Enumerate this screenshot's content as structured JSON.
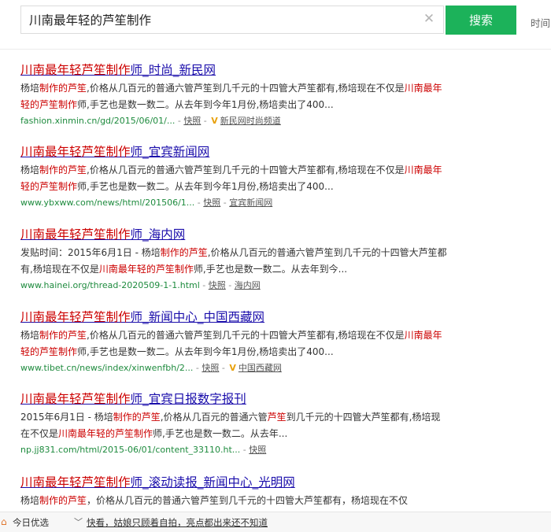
{
  "search": {
    "query": "川南最年轻的芦笙制作",
    "button_label": "搜索",
    "time_filter_label": "时间"
  },
  "results": [
    {
      "title": [
        {
          "t": "川南最年轻芦笙制作",
          "hl": true
        },
        {
          "t": "师_时尚_新民网",
          "hl": false
        }
      ],
      "desc": [
        {
          "t": "杨培",
          "hl": false
        },
        {
          "t": "制作的芦笙",
          "hl": true
        },
        {
          "t": ",价格从几百元的普通六管芦笙到几千元的十四管大芦笙都有,杨培现在不仅是",
          "hl": false
        },
        {
          "t": "川南最年轻的芦笙制作",
          "hl": true
        },
        {
          "t": "师,手艺也是数一数二。从去年到今年1月份,杨培卖出了400...",
          "hl": false
        }
      ],
      "url": "fashion.xinmin.cn/gd/2015/06/01/...",
      "cache": "快照",
      "verified": true,
      "source": "新民网时尚频道"
    },
    {
      "title": [
        {
          "t": "川南最年轻芦笙制作",
          "hl": true
        },
        {
          "t": "师_宜宾新闻网",
          "hl": false
        }
      ],
      "desc": [
        {
          "t": "杨培",
          "hl": false
        },
        {
          "t": "制作的芦笙",
          "hl": true
        },
        {
          "t": ",价格从几百元的普通六管芦笙到几千元的十四管大芦笙都有,杨培现在不仅是",
          "hl": false
        },
        {
          "t": "川南最年轻的芦笙制作",
          "hl": true
        },
        {
          "t": "师,手艺也是数一数二。从去年到今年1月份,杨培卖出了400...",
          "hl": false
        }
      ],
      "url": "www.ybxww.com/news/html/201506/1...",
      "cache": "快照",
      "verified": false,
      "source": "宜宾新闻网"
    },
    {
      "title": [
        {
          "t": "川南最年轻芦笙制作",
          "hl": true
        },
        {
          "t": "师_海内网",
          "hl": false
        }
      ],
      "desc": [
        {
          "t": "发贴时间：2015年6月1日 - 杨培",
          "hl": false
        },
        {
          "t": "制作的芦笙",
          "hl": true
        },
        {
          "t": ",价格从几百元的普通六管芦笙到几千元的十四管大芦笙都有,杨培现在不仅是",
          "hl": false
        },
        {
          "t": "川南最年轻的芦笙制作",
          "hl": true
        },
        {
          "t": "师,手艺也是数一数二。从去年到今...",
          "hl": false
        }
      ],
      "url": "www.hainei.org/thread-2020509-1-1.html",
      "cache": "快照",
      "verified": false,
      "source": "海内网"
    },
    {
      "title": [
        {
          "t": "川南最年轻芦笙制作",
          "hl": true
        },
        {
          "t": "师_新闻中心_中国西藏网",
          "hl": false
        }
      ],
      "desc": [
        {
          "t": "杨培",
          "hl": false
        },
        {
          "t": "制作的芦笙",
          "hl": true
        },
        {
          "t": ",价格从几百元的普通六管芦笙到几千元的十四管大芦笙都有,杨培现在不仅是",
          "hl": false
        },
        {
          "t": "川南最年轻的芦笙制作",
          "hl": true
        },
        {
          "t": "师,手艺也是数一数二。从去年到今年1月份,杨培卖出了400...",
          "hl": false
        }
      ],
      "url": "www.tibet.cn/news/index/xinwenfbh/2...",
      "cache": "快照",
      "verified": true,
      "source": "中国西藏网"
    },
    {
      "title": [
        {
          "t": "川南最年轻芦笙制作",
          "hl": true
        },
        {
          "t": "师_宜宾日报数字报刊",
          "hl": false
        }
      ],
      "desc": [
        {
          "t": "2015年6月1日 - 杨培",
          "hl": false
        },
        {
          "t": "制作的芦笙",
          "hl": true
        },
        {
          "t": ",价格从几百元的普通六管",
          "hl": false
        },
        {
          "t": "芦笙",
          "hl": true
        },
        {
          "t": "到几千元的十四管大芦笙都有,杨培现在不仅是",
          "hl": false
        },
        {
          "t": "川南最年轻的芦笙制作",
          "hl": true
        },
        {
          "t": "师,手艺也是数一数二。从去年...",
          "hl": false
        }
      ],
      "url": "np.jj831.com/html/2015-06/01/content_33110.ht...",
      "cache": "快照",
      "verified": false,
      "source": ""
    },
    {
      "title": [
        {
          "t": "川南最年轻芦笙制作",
          "hl": true
        },
        {
          "t": "师_滚动读报_新闻中心_光明网",
          "hl": false
        }
      ],
      "desc": [
        {
          "t": "杨培",
          "hl": false
        },
        {
          "t": "制作的芦笙",
          "hl": true
        },
        {
          "t": "，价格从几百元的普通六管芦笙到几千元的十四管大芦笙都有，杨培现在不仅",
          "hl": false
        }
      ],
      "url": "",
      "cache": "",
      "verified": false,
      "source": ""
    }
  ],
  "bottombar": {
    "today_label": "今日优选",
    "news_text": "快看，姑娘只顾着自拍，亮点都出来还不知道"
  }
}
